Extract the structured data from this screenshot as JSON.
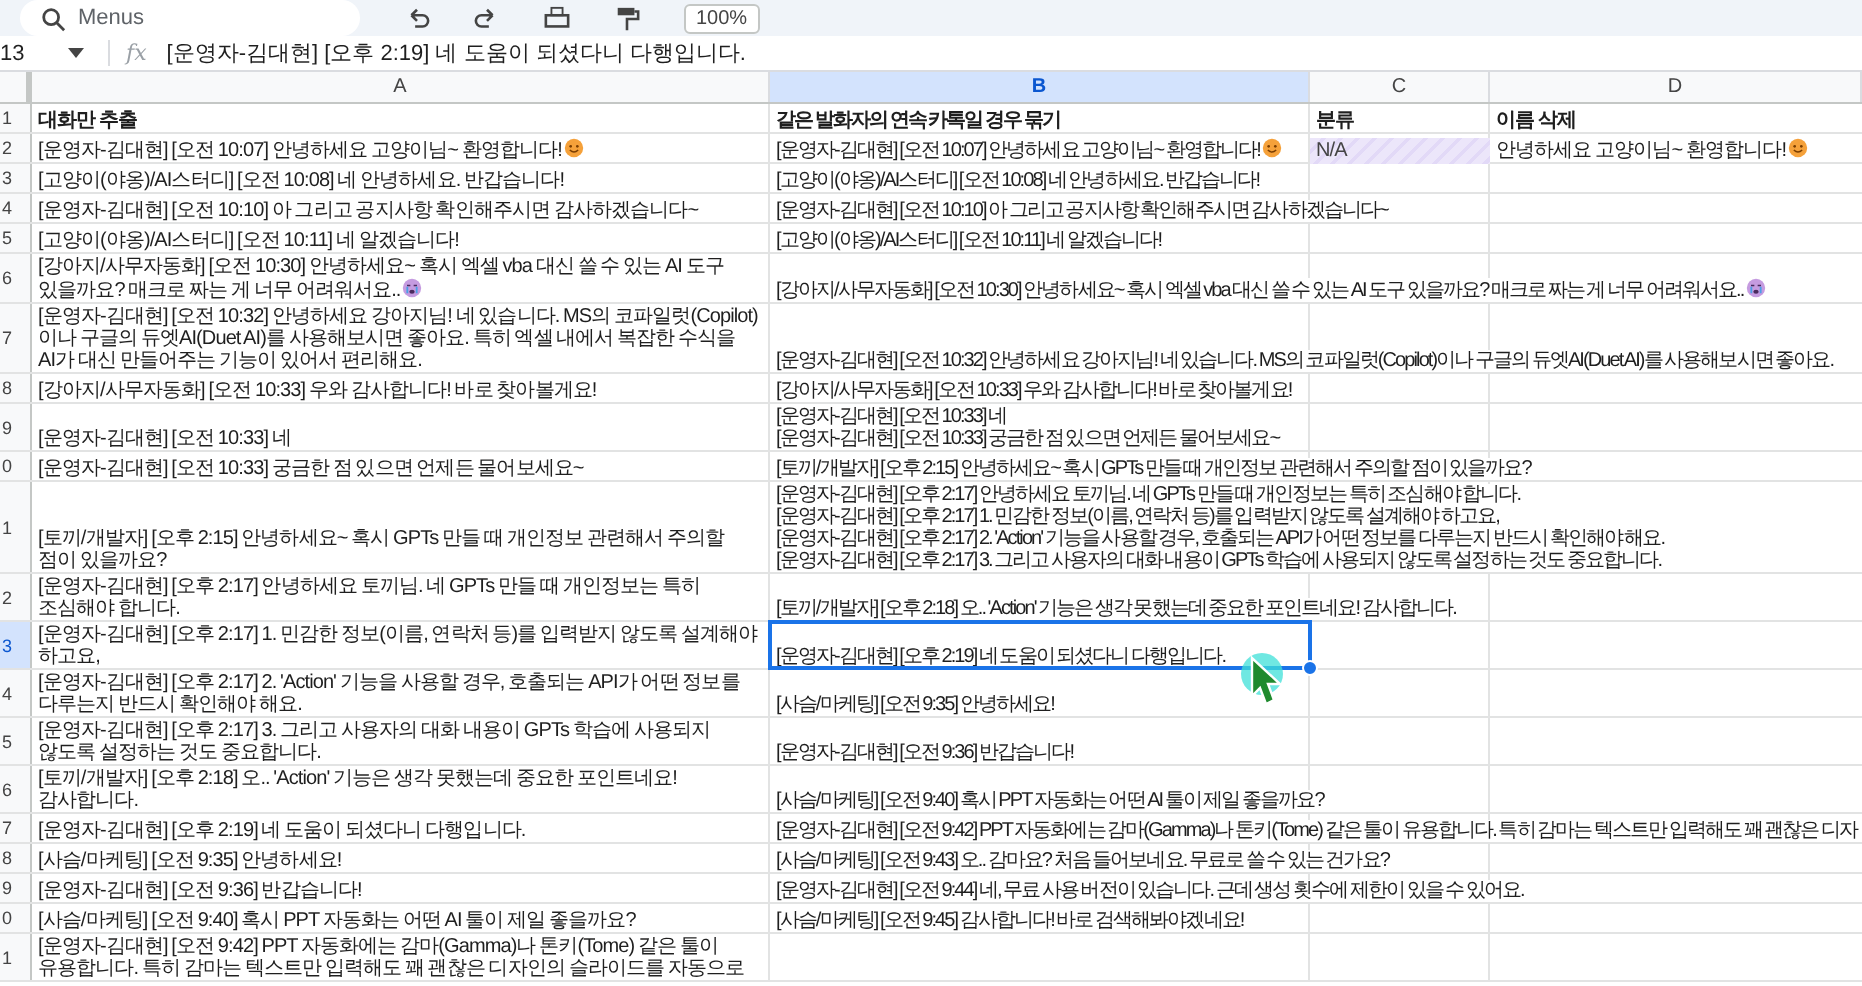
{
  "toolbar": {
    "search_placeholder": "Menus",
    "zoom": "100%"
  },
  "formula_bar": {
    "cell_ref": "13",
    "label": "fx",
    "formula": "[운영자-김대현] [오후 2:19] 네 도움이 되셨다니 다행입니다."
  },
  "columns": [
    {
      "label": "A",
      "selected": false
    },
    {
      "label": "B",
      "selected": true
    },
    {
      "label": "C",
      "selected": false
    },
    {
      "label": "D",
      "selected": false
    }
  ],
  "rows": [
    {
      "number": "1",
      "selected": false,
      "kind": "header",
      "a": "대화만 추출",
      "b": [
        "같은 발화자의 연속 카톡일 경우 묶기"
      ],
      "c": "분류",
      "d": "이름 삭제"
    },
    {
      "number": "2",
      "selected": false,
      "kind": "data",
      "a": {
        "text": "[운영자-김대현] [오전 10:07] 안녕하세요 고양이님~ 환영합니다!",
        "kind": "smile"
      },
      "b": [
        {
          "text": "[운영자-김대현] [오전 10:07] 안녕하세요 고양이님~ 환영합니다!",
          "kind": "smile"
        }
      ],
      "c": {
        "text": "N/A",
        "kind": "chip"
      },
      "d": {
        "text": "안녕하세요 고양이님~ 환영합니다!",
        "kind": "smile"
      }
    },
    {
      "number": "3",
      "selected": false,
      "kind": "data",
      "a": "[고양이(야옹)/AI스터디] [오전 10:08] 네 안녕하세요. 반갑습니다!",
      "b": [
        "[고양이(야옹)/AI스터디] [오전 10:08] 네 안녕하세요. 반갑습니다!"
      ]
    },
    {
      "number": "4",
      "selected": false,
      "kind": "data",
      "a": "[운영자-김대현] [오전 10:10] 아 그리고 공지사항 확인해주시면 감사하겠습니다~",
      "b": [
        "[운영자-김대현] [오전 10:10] 아 그리고 공지사항 확인해주시면 감사하겠습니다~"
      ]
    },
    {
      "number": "5",
      "selected": false,
      "kind": "data",
      "a": "[고양이(야옹)/AI스터디] [오전 10:11] 네 알겠습니다!",
      "b": [
        "[고양이(야옹)/AI스터디] [오전 10:11] 네 알겠습니다!"
      ]
    },
    {
      "number": "6",
      "selected": false,
      "kind": "data",
      "a": {
        "text": "[강아지/사무자동화] [오전 10:30] 안녕하세요~ 혹시 엑셀 vba 대신 쓸 수 있는 AI 도구 있을까요? 매크로 짜는 게 너무 어려워서요..",
        "kind": "cry"
      },
      "b": [
        {
          "text": "[강아지/사무자동화] [오전 10:30] 안녕하세요~ 혹시 엑셀 vba 대신 쓸 수 있는 AI 도구 있을까요? 매크로 짜는 게 너무 어려워서요..",
          "kind": "cry"
        }
      ]
    },
    {
      "number": "7",
      "selected": false,
      "kind": "data",
      "a": "[운영자-김대현] [오전 10:32] 안녕하세요 강아지님! 네 있습니다. MS의 코파일럿(Copilot)이나 구글의 듀엣AI(Duet AI)를 사용해보시면 좋아요. 특히 엑셀 내에서 복잡한 수식을 AI가 대신 만들어주는 기능이 있어서 편리해요.",
      "b": [
        "[운영자-김대현] [오전 10:32] 안녕하세요 강아지님! 네 있습니다. MS의 코파일럿(Copilot)이나 구글의 듀엣AI(Duet AI)를 사용해보시면 좋아요."
      ]
    },
    {
      "number": "8",
      "selected": false,
      "kind": "data",
      "a": "[강아지/사무자동화] [오전 10:33] 우와 감사합니다! 바로 찾아볼게요!",
      "b": [
        "[강아지/사무자동화] [오전 10:33] 우와 감사합니다! 바로 찾아볼게요!"
      ]
    },
    {
      "number": "9",
      "selected": false,
      "kind": "data",
      "a": "[운영자-김대현] [오전 10:33] 네",
      "b": [
        "[운영자-김대현] [오전 10:33] 네",
        "[운영자-김대현] [오전 10:33] 궁금한 점 있으면 언제든 물어보세요~"
      ]
    },
    {
      "number": "0",
      "selected": false,
      "kind": "data",
      "a": "[운영자-김대현] [오전 10:33] 궁금한 점 있으면 언제든 물어보세요~",
      "b": [
        "[토끼/개발자] [오후 2:15] 안녕하세요~ 혹시 GPTs 만들 때 개인정보 관련해서 주의할 점이 있을까요?"
      ]
    },
    {
      "number": "1",
      "selected": false,
      "kind": "data",
      "a": "[토끼/개발자] [오후 2:15] 안녕하세요~ 혹시 GPTs 만들 때 개인정보 관련해서 주의할 점이 있을까요?",
      "b": [
        "[운영자-김대현] [오후 2:17] 안녕하세요 토끼님. 네 GPTs 만들 때 개인정보는 특히 조심해야 합니다.",
        "[운영자-김대현] [오후 2:17] 1. 민감한 정보(이름, 연락처 등)를 입력받지 않도록 설계해야 하고요,",
        "[운영자-김대현] [오후 2:17] 2. 'Action' 기능을 사용할 경우, 호출되는 API가 어떤 정보를 다루는지 반드시 확인해야 해요.",
        "[운영자-김대현] [오후 2:17] 3. 그리고 사용자의 대화 내용이 GPTs 학습에 사용되지 않도록 설정하는 것도 중요합니다."
      ]
    },
    {
      "number": "2",
      "selected": false,
      "kind": "data",
      "a": "[운영자-김대현] [오후 2:17] 안녕하세요 토끼님. 네 GPTs 만들 때 개인정보는 특히 조심해야 합니다.",
      "b": [
        "[토끼/개발자] [오후 2:18] 오.. 'Action' 기능은 생각 못했는데 중요한 포인트네요! 감사합니다."
      ]
    },
    {
      "number": "3",
      "selected": true,
      "kind": "data",
      "a": "[운영자-김대현] [오후 2:17] 1. 민감한 정보(이름, 연락처 등)를 입력받지 않도록 설계해야 하고요,",
      "b": [
        "[운영자-김대현] [오후 2:19] 네 도움이 되셨다니 다행입니다."
      ]
    },
    {
      "number": "4",
      "selected": false,
      "kind": "data",
      "a": "[운영자-김대현] [오후 2:17] 2. 'Action' 기능을 사용할 경우, 호출되는 API가 어떤 정보를 다루는지 반드시 확인해야 해요.",
      "b": [
        "[사슴/마케팅] [오전 9:35] 안녕하세요!"
      ]
    },
    {
      "number": "5",
      "selected": false,
      "kind": "data",
      "a": "[운영자-김대현] [오후 2:17] 3. 그리고 사용자의 대화 내용이 GPTs 학습에 사용되지 않도록 설정하는 것도 중요합니다.",
      "b": [
        "[운영자-김대현] [오전 9:36] 반갑습니다!"
      ]
    },
    {
      "number": "6",
      "selected": false,
      "kind": "data",
      "a": "[토끼/개발자] [오후 2:18] 오.. 'Action' 기능은 생각 못했는데 중요한 포인트네요! 감사합니다.",
      "b": [
        "[사슴/마케팅] [오전 9:40] 혹시 PPT 자동화는 어떤 AI 툴이 제일 좋을까요?"
      ]
    },
    {
      "number": "7",
      "selected": false,
      "kind": "data",
      "a": "[운영자-김대현] [오후 2:19] 네 도움이 되셨다니 다행입니다.",
      "b": [
        "[운영자-김대현] [오전 9:42] PPT 자동화에는 감마(Gamma)나 톤키(Tome) 같은 툴이 유용합니다. 특히 감마는 텍스트만 입력해도 꽤 괜찮은 디자"
      ]
    },
    {
      "number": "8",
      "selected": false,
      "kind": "data",
      "a": "[사슴/마케팅] [오전 9:35] 안녕하세요!",
      "b": [
        "[사슴/마케팅] [오전 9:43] 오.. 감마요? 처음 들어보네요. 무료로 쓸 수 있는 건가요?"
      ]
    },
    {
      "number": "9",
      "selected": false,
      "kind": "data",
      "a": "[운영자-김대현] [오전 9:36] 반갑습니다!",
      "b": [
        "[운영자-김대현] [오전 9:44] 네, 무료 사용 버전이 있습니다. 근데 생성 횟수에 제한이 있을 수 있어요."
      ]
    },
    {
      "number": "0",
      "selected": false,
      "kind": "data",
      "a": "[사슴/마케팅] [오전 9:40] 혹시 PPT 자동화는 어떤 AI 툴이 제일 좋을까요?",
      "b": [
        "[사슴/마케팅] [오전 9:45] 감사합니다! 바로 검색해봐야겠네요!"
      ]
    },
    {
      "number": "1",
      "selected": false,
      "kind": "data",
      "a": "[운영자-김대현] [오전 9:42] PPT 자동화에는 감마(Gamma)나 톤키(Tome) 같은 툴이 유용합니다. 특히 감마는 텍스트만 입력해도 꽤 괜찮은 디자인의 슬라이드를 자동으로",
      "b": []
    }
  ]
}
